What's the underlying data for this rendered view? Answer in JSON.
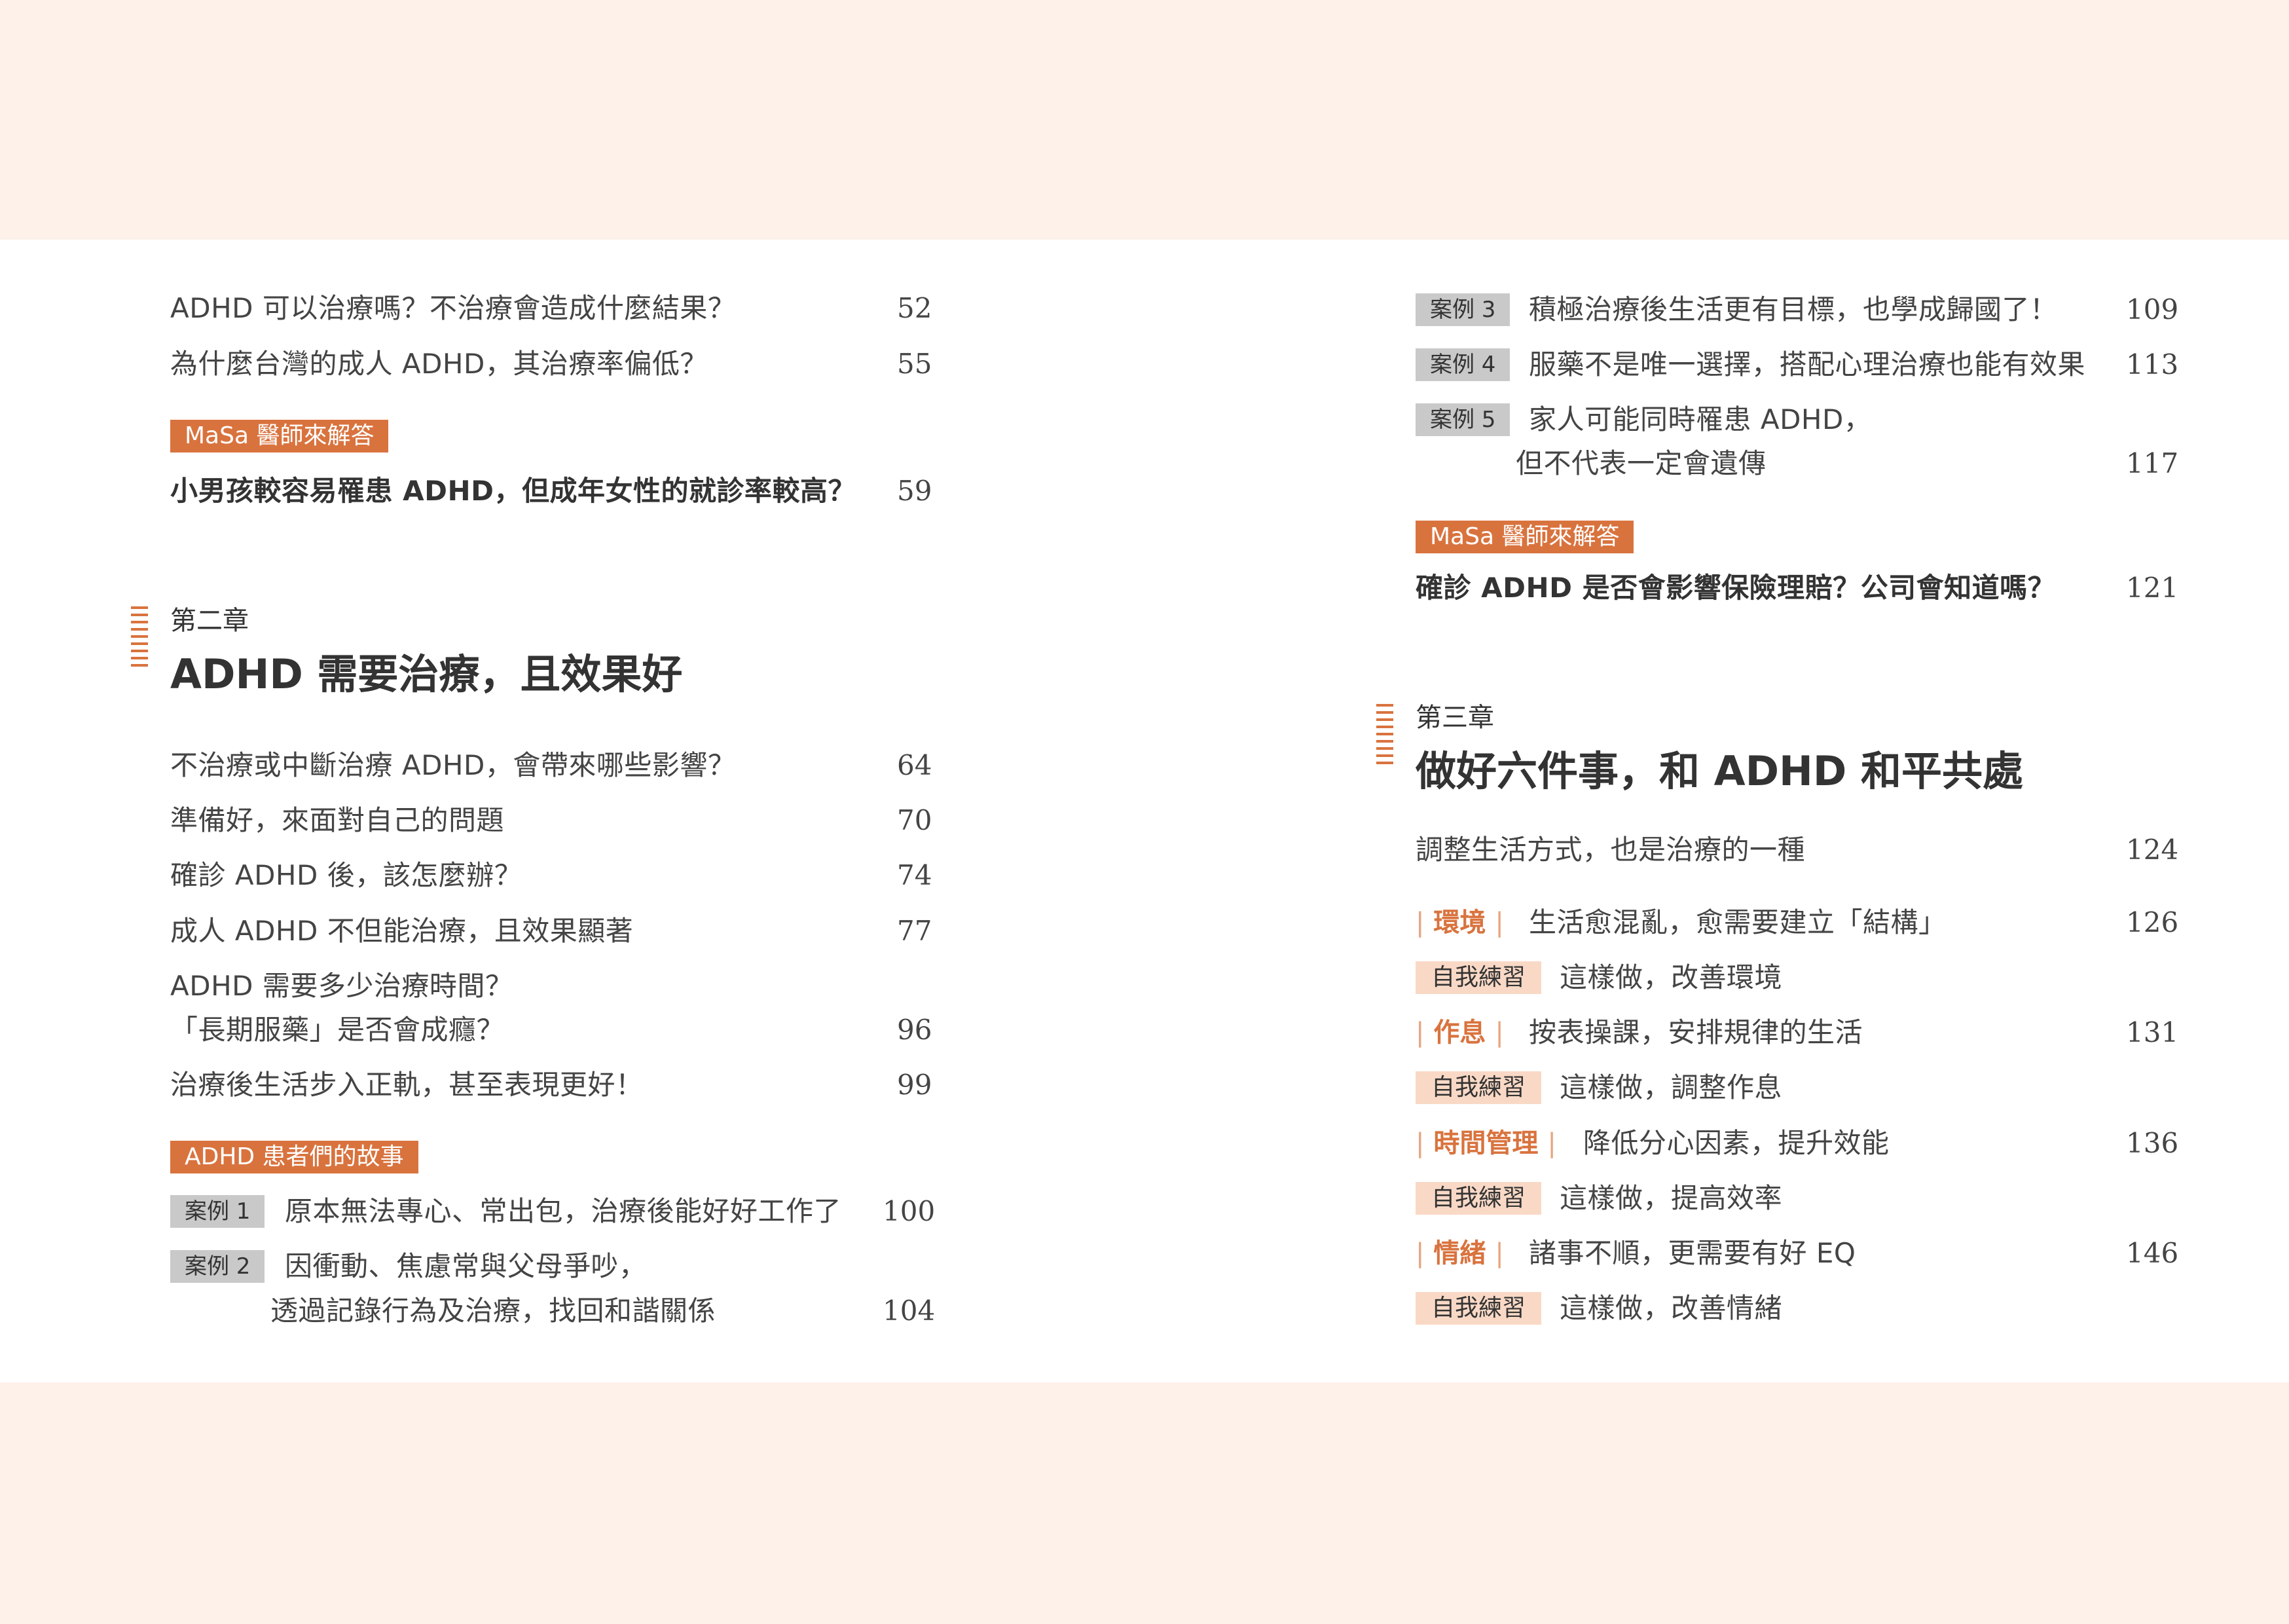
{
  "left": {
    "entries_top": [
      {
        "title": "ADHD 可以治療嗎？不治療會造成什麼結果？",
        "page": "52"
      },
      {
        "title": "為什麼台灣的成人 ADHD，其治療率偏低？",
        "page": "55"
      }
    ],
    "masa_tag": "MaSa 醫師來解答",
    "masa_entry": {
      "title": "小男孩較容易罹患 ADHD，但成年女性的就診率較高？",
      "page": "59"
    },
    "chapter": {
      "number": "第二章",
      "title": "ADHD 需要治療，且效果好"
    },
    "entries": [
      {
        "title": "不治療或中斷治療 ADHD，會帶來哪些影響？",
        "page": "64"
      },
      {
        "title": "準備好，來面對自己的問題",
        "page": "70"
      },
      {
        "title": "確診 ADHD 後，該怎麼辦？",
        "page": "74"
      },
      {
        "title": "成人 ADHD 不但能治療，且效果顯著",
        "page": "77"
      },
      {
        "title_line1": "ADHD 需要多少治療時間？",
        "title_line2": "「長期服藥」是否會成癮？",
        "page": "96"
      },
      {
        "title": "治療後生活步入正軌，甚至表現更好！",
        "page": "99"
      }
    ],
    "stories_tag": "ADHD 患者們的故事",
    "cases": [
      {
        "label": "案例 1",
        "title": "原本無法專心、常出包，治療後能好好工作了",
        "page": "100"
      },
      {
        "label": "案例 2",
        "title_line1": "因衝動、焦慮常與父母爭吵，",
        "title_line2": "透過記錄行為及治療，找回和諧關係",
        "page": "104"
      }
    ]
  },
  "right": {
    "cases": [
      {
        "label": "案例 3",
        "title": "積極治療後生活更有目標，也學成歸國了！",
        "page": "109"
      },
      {
        "label": "案例 4",
        "title": "服藥不是唯一選擇，搭配心理治療也能有效果",
        "page": "113"
      },
      {
        "label": "案例 5",
        "title_line1": "家人可能同時罹患 ADHD，",
        "title_line2": "但不代表一定會遺傳",
        "page": "117"
      }
    ],
    "masa_tag": "MaSa 醫師來解答",
    "masa_entry": {
      "title": "確診 ADHD 是否會影響保險理賠？公司會知道嗎？",
      "page": "121"
    },
    "chapter": {
      "number": "第三章",
      "title": "做好六件事，和 ADHD 和平共處"
    },
    "intro_entry": {
      "title": "調整生活方式，也是治療的一種",
      "page": "124"
    },
    "sections": [
      {
        "category": "環境",
        "title": "生活愈混亂，愈需要建立「結構」",
        "page": "126",
        "exercise_tag": "自我練習",
        "exercise": "這樣做，改善環境"
      },
      {
        "category": "作息",
        "title": "按表操課，安排規律的生活",
        "page": "131",
        "exercise_tag": "自我練習",
        "exercise": "這樣做，調整作息"
      },
      {
        "category": "時間管理",
        "title": "降低分心因素，提升效能",
        "page": "136",
        "exercise_tag": "自我練習",
        "exercise": "這樣做，提高效率"
      },
      {
        "category": "情緒",
        "title": "諸事不順，更需要有好 EQ",
        "page": "146",
        "exercise_tag": "自我練習",
        "exercise": "這樣做，改善情緒"
      }
    ]
  },
  "colors": {
    "accent": "#d9733e",
    "tag_gray": "#c9c9c9",
    "tag_peach": "#f9d9c6",
    "page_bg": "#fdf1ea"
  }
}
